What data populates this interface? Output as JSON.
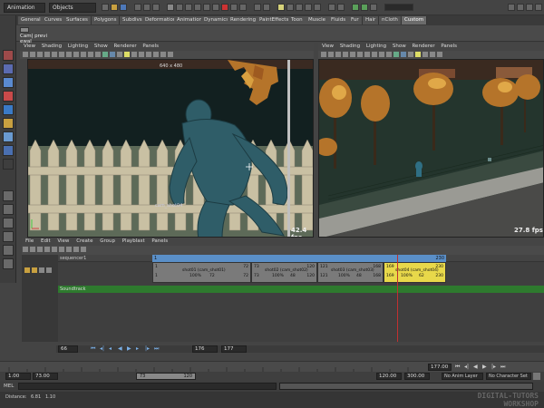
{
  "topbar": {
    "mode": "Animation",
    "objects_field": "Objects"
  },
  "shelf_tabs": [
    "General",
    "Curves",
    "Surfaces",
    "Polygons",
    "Subdivs",
    "Deformation",
    "Animation",
    "Dynamics",
    "Rendering",
    "PaintEffects",
    "Toon",
    "Muscle",
    "Fluids",
    "Fur",
    "Hair",
    "nCloth",
    "Custom"
  ],
  "shelf": {
    "cam_button_label": "Cam| previ ewal"
  },
  "viewport_menu": [
    "View",
    "Shading",
    "Lighting",
    "Show",
    "Renderer",
    "Panels"
  ],
  "viewport_left": {
    "resolution": "640 x 480",
    "camera_label": "cam_shot04",
    "fps": "42.4 fps"
  },
  "viewport_right": {
    "fps": "27.8 fps"
  },
  "trax": {
    "menu": [
      "File",
      "Edit",
      "View",
      "Create",
      "Group",
      "Playblast",
      "Panels"
    ],
    "sequencer_track": "sequencer1",
    "soundtrack": "Soundtrack",
    "ruler_start": "1",
    "ruler_end": "230",
    "shots": [
      {
        "name": "shot01 (cam_shot01)",
        "start": "1",
        "end": "72",
        "pct": "100%",
        "dur": "72"
      },
      {
        "name": "shot02 (cam_shot02)",
        "start": "73",
        "end": "120",
        "pct": "100%",
        "dur": "48"
      },
      {
        "name": "shot03 (cam_shot03)",
        "start": "121",
        "end": "168",
        "pct": "100%",
        "dur": "48"
      },
      {
        "name": "shot04 (cam_shot04)",
        "start": "169",
        "end": "230",
        "pct": "100%",
        "dur": "62"
      }
    ],
    "frame_field_left": "66",
    "frame_field_mid": "176",
    "frame_field_mid2": "177"
  },
  "timeline": {
    "current_frame": "177.00"
  },
  "range": {
    "start": "1.00",
    "inner_start": "73.00",
    "slider_start": "73",
    "slider_end": "120",
    "inner_end": "120.00",
    "end": "300.00",
    "anim_layer": "No Anim Layer",
    "char_set": "No Character Set"
  },
  "cmdline": {
    "label": "MEL"
  },
  "help": {
    "text_label": "Distance:",
    "val1": "6.81",
    "val2": "1.10"
  },
  "watermark": {
    "line1": "DIGITAL-TUTORS",
    "line2": "WORKSHOP"
  }
}
